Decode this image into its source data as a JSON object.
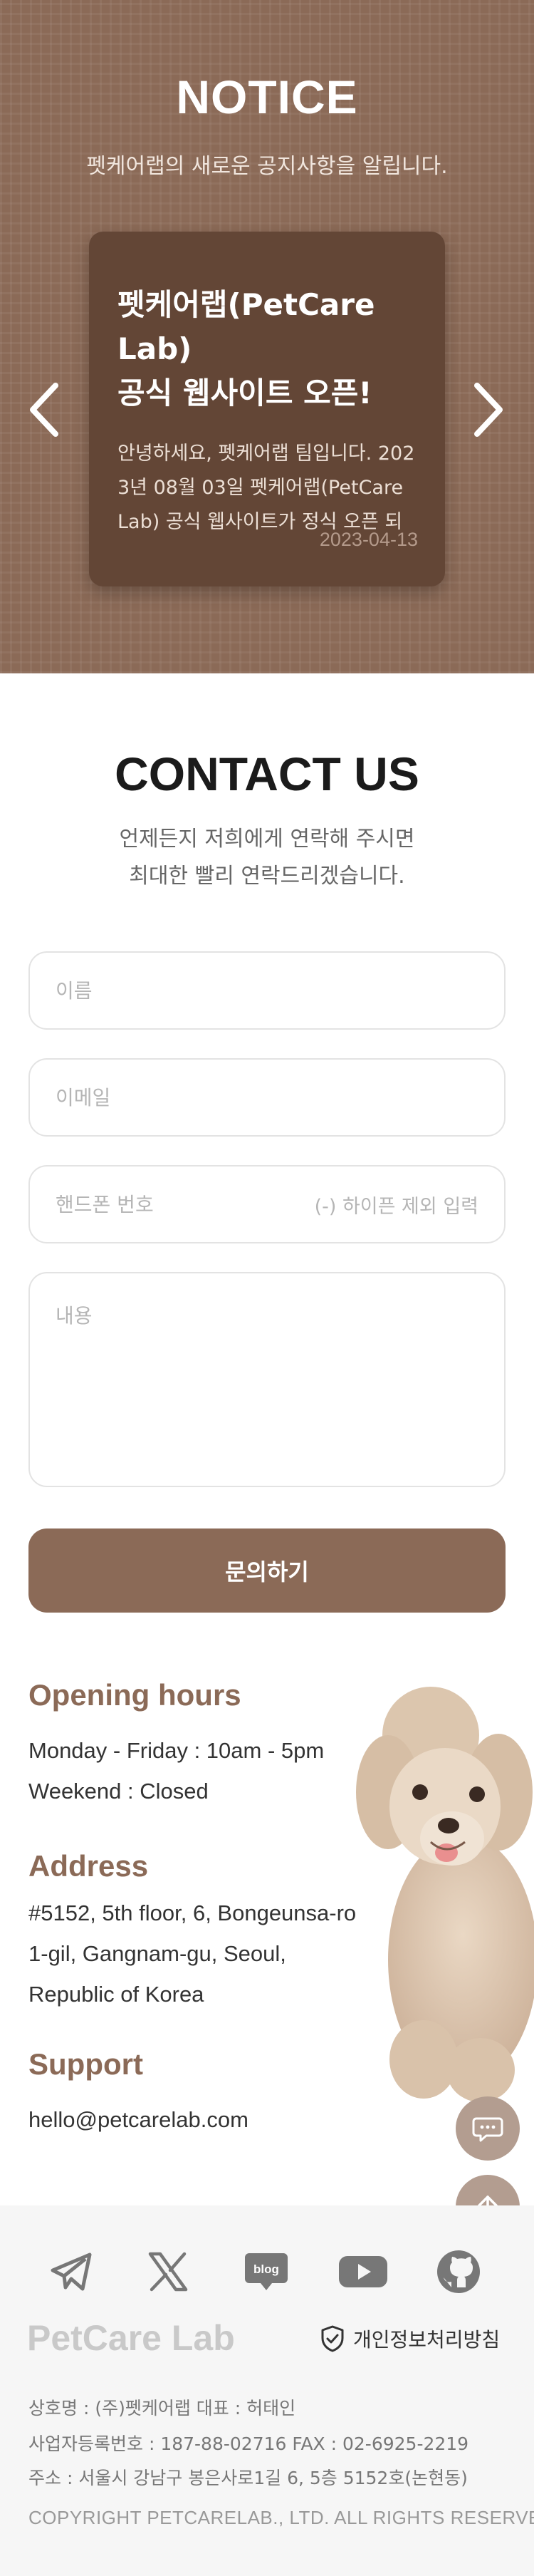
{
  "notice": {
    "title": "NOTICE",
    "subtitle": "펫케어랩의 새로운 공지사항을 알립니다.",
    "card": {
      "title_line1": "펫케어랩(PetCare Lab)",
      "title_line2": "공식 웹사이트 오픈!",
      "body": "안녕하세요, 펫케어랩 팀입니다. 2023년 08월 03일 펫케어랩(PetCare Lab) 공식 웹사이트가 정식 오픈 되었...",
      "date": "2023-04-13"
    },
    "prev_icon": "chevron-left-icon",
    "next_icon": "chevron-right-icon"
  },
  "contact": {
    "title": "CONTACT US",
    "subtitle_line1": "언제든지 저희에게 연락해 주시면",
    "subtitle_line2": "최대한 빨리 연락드리겠습니다.",
    "name_placeholder": "이름",
    "email_placeholder": "이메일",
    "phone_placeholder": "핸드폰 번호",
    "phone_hint": "(-) 하이픈 제외 입력",
    "message_placeholder": "내용",
    "submit_label": "문의하기"
  },
  "info": {
    "hours_heading": "Opening hours",
    "hours_weekday": "Monday - Friday : 10am - 5pm",
    "hours_weekend": "Weekend : Closed",
    "address_heading": "Address",
    "address_text": "#5152, 5th floor, 6, Bongeunsa-ro 1-gil, Gangnam-gu, Seoul, Republic of Korea",
    "support_heading": "Support",
    "support_email": "hello@petcarelab.com"
  },
  "floating": {
    "chat_icon": "chat-icon",
    "top_icon": "arrow-up-icon"
  },
  "footer": {
    "social_icons": [
      "telegram-icon",
      "x-icon",
      "blog-icon",
      "youtube-icon",
      "github-icon"
    ],
    "blog_label": "blog",
    "logo": "PetCare Lab",
    "privacy_label": "개인정보처리방침",
    "company_line": "상호명 : (주)펫케어랩    대표 : 허태인",
    "registration_line": "사업자등록번호 : 187-88-02716    FAX : 02-6925-2219",
    "address_line": "주소 : 서울시 강남구 봉은사로1길 6, 5층 5152호(논현동)",
    "copyright": "COPYRIGHT PETCARELAB., LTD. ALL RIGHTS RESERVED."
  },
  "colors": {
    "brand": "#8b6a57",
    "card": "#634636",
    "footer_bg": "#f6f6f6"
  }
}
